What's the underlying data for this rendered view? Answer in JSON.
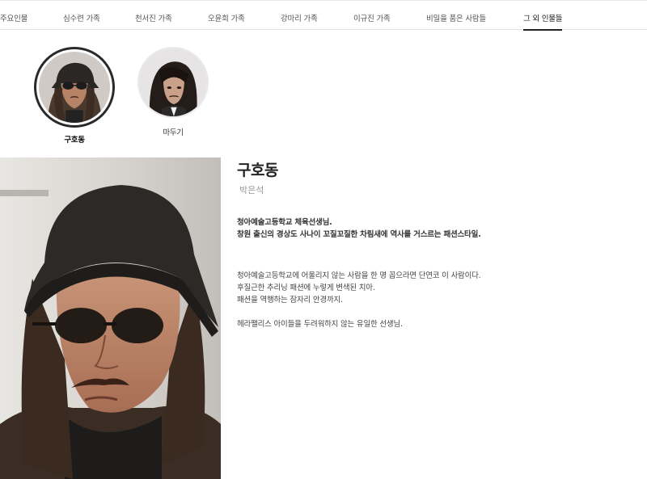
{
  "tabs": [
    {
      "label": "주요인물"
    },
    {
      "label": "심수련 가족"
    },
    {
      "label": "천서진 가족"
    },
    {
      "label": "오윤희 가족"
    },
    {
      "label": "강마리 가족"
    },
    {
      "label": "이규진 가족"
    },
    {
      "label": "비밀을 품은 사람들"
    },
    {
      "label": "그 외 인물들",
      "active": true
    }
  ],
  "characters": [
    {
      "name": "구호동",
      "active": true
    },
    {
      "name": "마두기",
      "active": false
    }
  ],
  "detail": {
    "name": "구호동",
    "actor": "박은석",
    "summary": [
      "청아예술고등학교 체육선생님.",
      "창원 출신의 경상도 사나이 꼬질꼬질한 차림새에 역사를 거스르는 패션스타일."
    ],
    "description": [
      "청아예술고등학교에 어울리지 않는 사람을 한 명 꼽으라면 단연코 이 사람이다.",
      "후질근한 추리닝 패션에 누렇게 변색된 치아.",
      "패션을 역행하는 잠자리 안경까지.",
      "",
      "헤라팰리스 아이들을 두려워하지 않는 유일한 선생님."
    ]
  }
}
